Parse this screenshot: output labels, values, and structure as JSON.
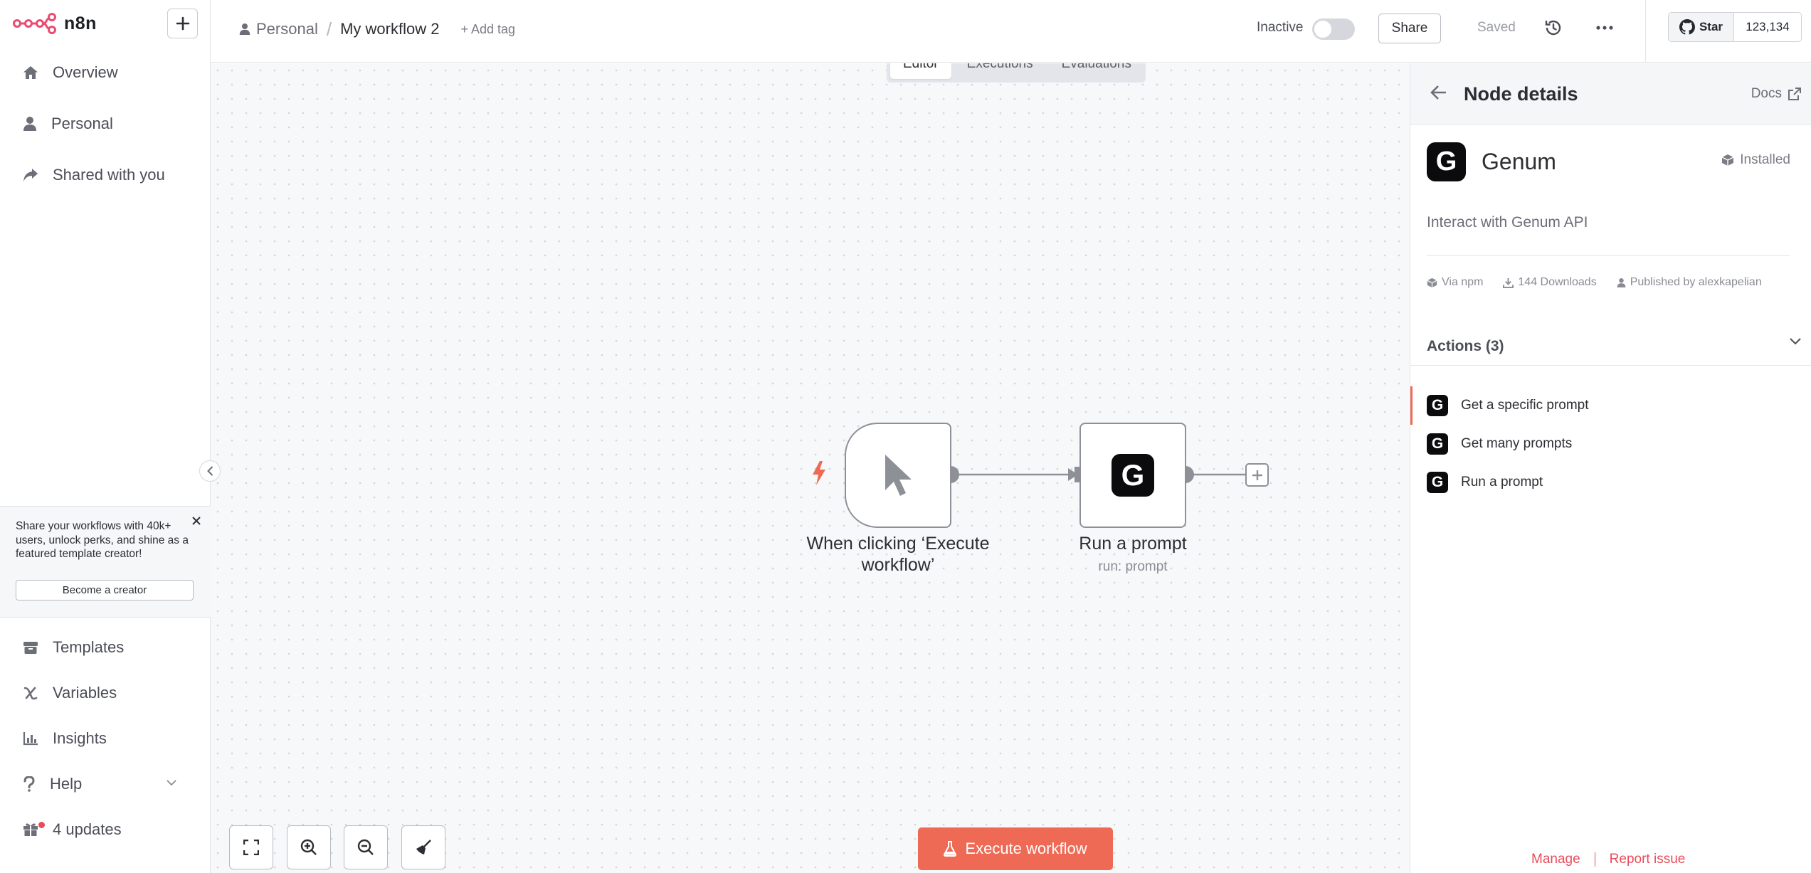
{
  "app": {
    "brand": "n8n"
  },
  "sidebar": {
    "nav_top": [
      {
        "label": "Overview",
        "icon": "home-icon"
      },
      {
        "label": "Personal",
        "icon": "user-icon"
      },
      {
        "label": "Shared with you",
        "icon": "share-icon"
      }
    ],
    "promo": {
      "text": "Share your workflows with 40k+ users, unlock perks, and shine as a featured template creator!",
      "button": "Become a creator"
    },
    "nav_bottom": [
      {
        "label": "Templates",
        "icon": "templates-icon"
      },
      {
        "label": "Variables",
        "icon": "variables-icon"
      },
      {
        "label": "Insights",
        "icon": "insights-icon"
      },
      {
        "label": "Help",
        "icon": "help-icon"
      },
      {
        "label": "4 updates",
        "icon": "gift-icon"
      }
    ]
  },
  "header": {
    "project": "Personal",
    "separator": "/",
    "workflow_name": "My workflow 2",
    "add_tag": "+ Add tag",
    "status_label": "Inactive",
    "share_label": "Share",
    "saved_label": "Saved",
    "github": {
      "star_label": "Star",
      "count": "123,134"
    }
  },
  "canvas": {
    "tabs": [
      {
        "label": "Editor",
        "active": true
      },
      {
        "label": "Executions",
        "active": false
      },
      {
        "label": "Evaluations",
        "active": false
      }
    ],
    "nodes": {
      "trigger": {
        "label": "When clicking ‘Execute workflow’"
      },
      "action": {
        "label": "Run a prompt",
        "subtitle": "run: prompt",
        "logo_letter": "G"
      }
    },
    "execute_button": "Execute workflow"
  },
  "panel": {
    "title": "Node details",
    "docs_label": "Docs",
    "node_name": "Genum",
    "logo_letter": "G",
    "installed_label": "Installed",
    "description": "Interact with Genum API",
    "meta": {
      "source": "Via npm",
      "downloads": "144 Downloads",
      "publisher": "Published by alexkapelian"
    },
    "actions_header": "Actions (3)",
    "actions": [
      {
        "label": "Get a specific prompt",
        "selected": true
      },
      {
        "label": "Get many prompts",
        "selected": false
      },
      {
        "label": "Run a prompt",
        "selected": false
      }
    ],
    "footer": {
      "manage": "Manage",
      "report": "Report issue"
    }
  },
  "colors": {
    "accent": "#ee6a55",
    "brand": "#ea4b71",
    "logo_bg": "#0b0b0d"
  }
}
